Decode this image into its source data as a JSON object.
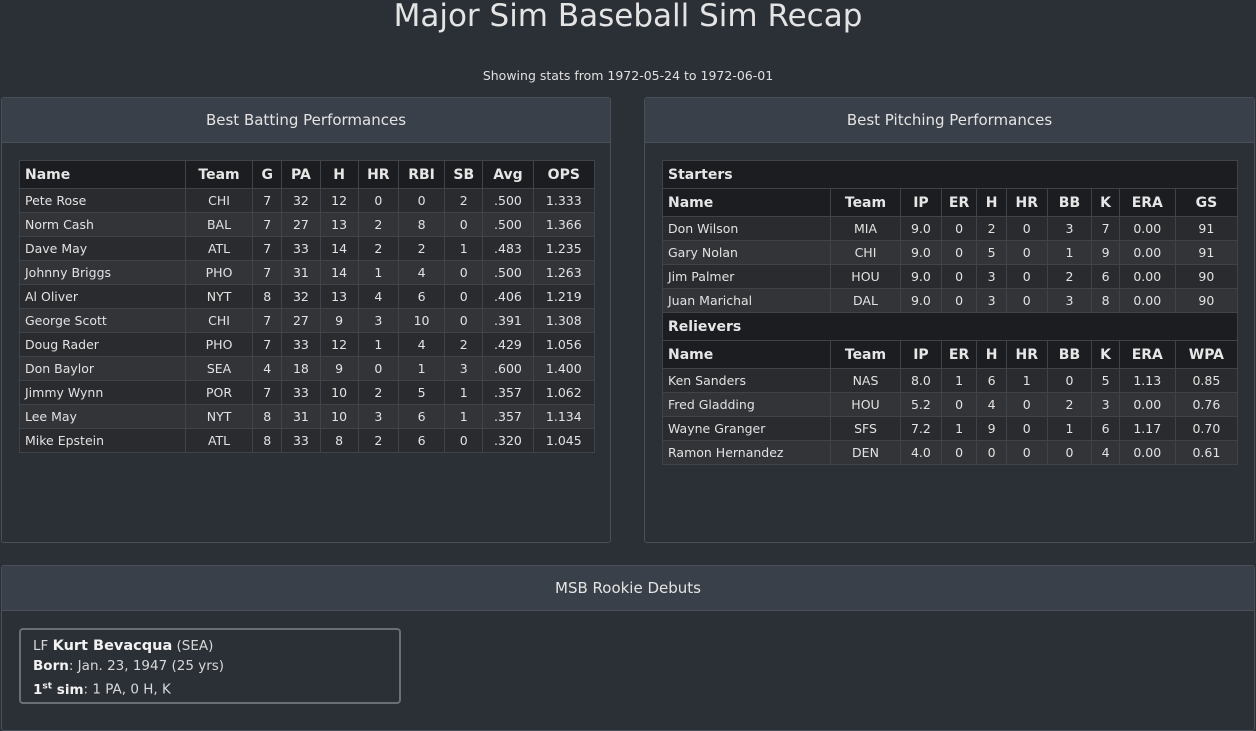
{
  "page": {
    "title": "Major Sim Baseball Sim Recap",
    "subtitle": "Showing stats from 1972-05-24 to 1972-06-01"
  },
  "batting": {
    "heading": "Best Batting Performances",
    "columns": [
      "Name",
      "Team",
      "G",
      "PA",
      "H",
      "HR",
      "RBI",
      "SB",
      "Avg",
      "OPS"
    ],
    "rows": [
      [
        "Pete Rose",
        "CHI",
        "7",
        "32",
        "12",
        "0",
        "0",
        "2",
        ".500",
        "1.333"
      ],
      [
        "Norm Cash",
        "BAL",
        "7",
        "27",
        "13",
        "2",
        "8",
        "0",
        ".500",
        "1.366"
      ],
      [
        "Dave May",
        "ATL",
        "7",
        "33",
        "14",
        "2",
        "2",
        "1",
        ".483",
        "1.235"
      ],
      [
        "Johnny Briggs",
        "PHO",
        "7",
        "31",
        "14",
        "1",
        "4",
        "0",
        ".500",
        "1.263"
      ],
      [
        "Al Oliver",
        "NYT",
        "8",
        "32",
        "13",
        "4",
        "6",
        "0",
        ".406",
        "1.219"
      ],
      [
        "George Scott",
        "CHI",
        "7",
        "27",
        "9",
        "3",
        "10",
        "0",
        ".391",
        "1.308"
      ],
      [
        "Doug Rader",
        "PHO",
        "7",
        "33",
        "12",
        "1",
        "4",
        "2",
        ".429",
        "1.056"
      ],
      [
        "Don Baylor",
        "SEA",
        "4",
        "18",
        "9",
        "0",
        "1",
        "3",
        ".600",
        "1.400"
      ],
      [
        "Jimmy Wynn",
        "POR",
        "7",
        "33",
        "10",
        "2",
        "5",
        "1",
        ".357",
        "1.062"
      ],
      [
        "Lee May",
        "NYT",
        "8",
        "31",
        "10",
        "3",
        "6",
        "1",
        ".357",
        "1.134"
      ],
      [
        "Mike Epstein",
        "ATL",
        "8",
        "33",
        "8",
        "2",
        "6",
        "0",
        ".320",
        "1.045"
      ]
    ]
  },
  "pitching": {
    "heading": "Best Pitching Performances",
    "starters": {
      "label": "Starters",
      "columns": [
        "Name",
        "Team",
        "IP",
        "ER",
        "H",
        "HR",
        "BB",
        "K",
        "ERA",
        "GS"
      ],
      "rows": [
        [
          "Don Wilson",
          "MIA",
          "9.0",
          "0",
          "2",
          "0",
          "3",
          "7",
          "0.00",
          "91"
        ],
        [
          "Gary Nolan",
          "CHI",
          "9.0",
          "0",
          "5",
          "0",
          "1",
          "9",
          "0.00",
          "91"
        ],
        [
          "Jim Palmer",
          "HOU",
          "9.0",
          "0",
          "3",
          "0",
          "2",
          "6",
          "0.00",
          "90"
        ],
        [
          "Juan Marichal",
          "DAL",
          "9.0",
          "0",
          "3",
          "0",
          "3",
          "8",
          "0.00",
          "90"
        ]
      ]
    },
    "relievers": {
      "label": "Relievers",
      "columns": [
        "Name",
        "Team",
        "IP",
        "ER",
        "H",
        "HR",
        "BB",
        "K",
        "ERA",
        "WPA"
      ],
      "rows": [
        [
          "Ken Sanders",
          "NAS",
          "8.0",
          "1",
          "6",
          "1",
          "0",
          "5",
          "1.13",
          "0.85"
        ],
        [
          "Fred Gladding",
          "HOU",
          "5.2",
          "0",
          "4",
          "0",
          "2",
          "3",
          "0.00",
          "0.76"
        ],
        [
          "Wayne Granger",
          "SFS",
          "7.2",
          "1",
          "9",
          "0",
          "1",
          "6",
          "1.17",
          "0.70"
        ],
        [
          "Ramon Hernandez",
          "DEN",
          "4.0",
          "0",
          "0",
          "0",
          "0",
          "4",
          "0.00",
          "0.61"
        ]
      ]
    }
  },
  "debuts": {
    "heading": "MSB Rookie Debuts",
    "cards": [
      {
        "position": "LF",
        "name": "Kurt Bevacqua",
        "team": "(SEA)",
        "born_label": "Born",
        "born_value": ": Jan. 23, 1947 (25 yrs)",
        "first_label_main": "1",
        "first_label_sup": "st",
        "first_label_rest": " sim",
        "first_value": ": 1 PA, 0 H, K"
      }
    ]
  }
}
